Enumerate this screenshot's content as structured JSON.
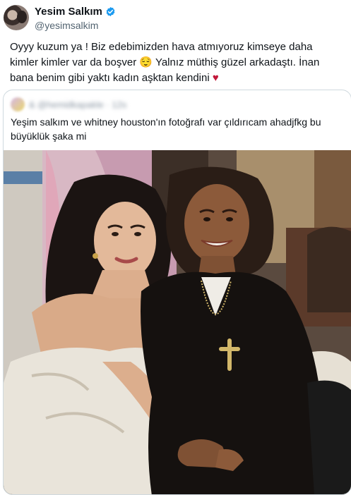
{
  "author": {
    "name": "Yesim Salkım",
    "handle": "@yesimsalkim"
  },
  "tweet": {
    "text": "Oyyy kuzum ya ! Biz edebimizden hava atmıyoruz kimseye daha kimler kimler var da boşver 😌 Yalnız müthiş güzel arkadaştı. İnan bana benim gibi yaktı kadın aşktan kendini",
    "emoji_heart": "♥"
  },
  "quoted": {
    "blurred_header": "& @hemidkapakle · 12s",
    "text": "Yeşim salkım ve whitney houston'ın fotoğrafı var çıldırıcam ahadjfkg bu büyüklük şaka mi"
  },
  "colors": {
    "verified": "#1d9bf0",
    "text": "#0f1419",
    "muted": "#536471",
    "border": "#cfd9de"
  }
}
